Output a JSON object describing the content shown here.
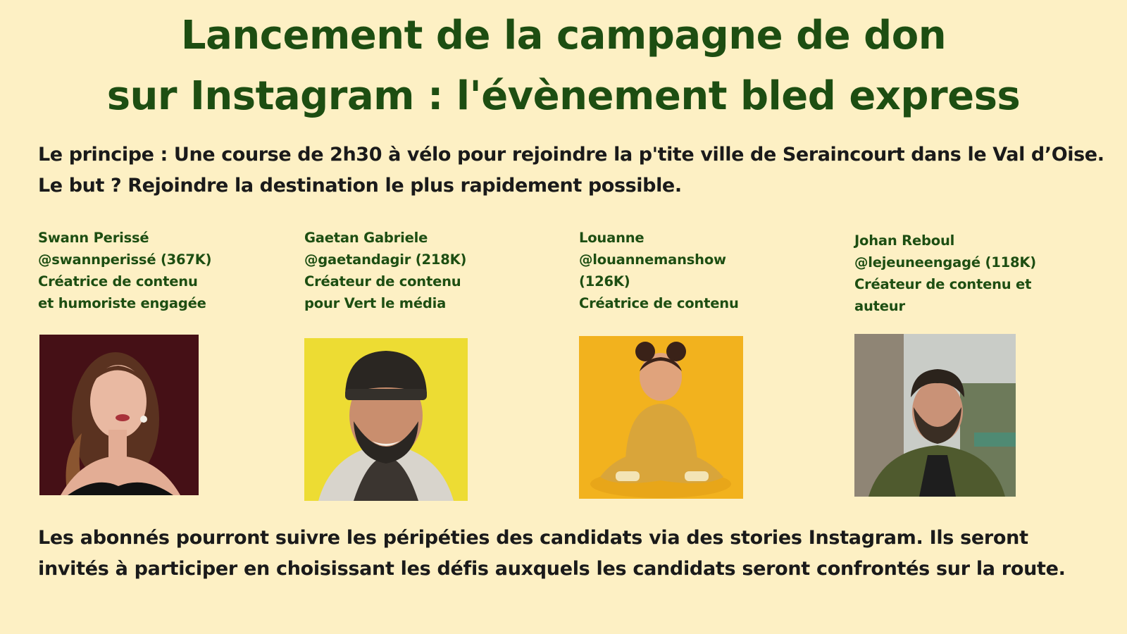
{
  "title": {
    "line1": "Lancement de la campagne de don",
    "line2": "sur Instagram : l'évènement  bled express"
  },
  "principle": "Le principe : Une course de 2h30 à vélo pour rejoindre la p'tite ville de Seraincourt dans le Val d’Oise. Le but ? Rejoindre la destination le plus rapidement possible.",
  "people": [
    {
      "lines": [
        "Swann Perissé",
        "@swannperissé (367K)",
        "Créatrice de contenu",
        "et humoriste engagée"
      ],
      "photo": {
        "background": "#3a0d12",
        "skin": "#e9b9a2",
        "hair": "#5a3220",
        "clothing": "#111111"
      }
    },
    {
      "lines": [
        "Gaetan Gabriele",
        "@gaetandagir (218K)",
        "Créateur de contenu",
        "pour Vert le média"
      ],
      "photo": {
        "background": "#eddc33",
        "skin": "#c98e6e",
        "hair": "#2a2622",
        "clothing": "#d8d4cc"
      }
    },
    {
      "lines": [
        "Louanne",
        "@louannemanshow",
        "(126K)",
        "Créatrice de contenu"
      ],
      "photo": {
        "background": "#f2b21e",
        "skin": "#e0a37c",
        "hair": "#3a2218",
        "clothing": "#d9a53a"
      }
    },
    {
      "lines": [
        "Johan Reboul",
        "@lejeuneengagé (118K)",
        "Créateur de contenu et",
        "auteur"
      ],
      "photo": {
        "background": "#c9ccc7",
        "skin": "#c99277",
        "hair": "#2b231c",
        "clothing": "#4f5a2e"
      }
    }
  ],
  "footer": "Les abonnés pourront suivre les péripéties des candidats via des stories Instagram. Ils seront invités à participer en choisissant les défis auxquels les candidats seront confrontés sur la route."
}
